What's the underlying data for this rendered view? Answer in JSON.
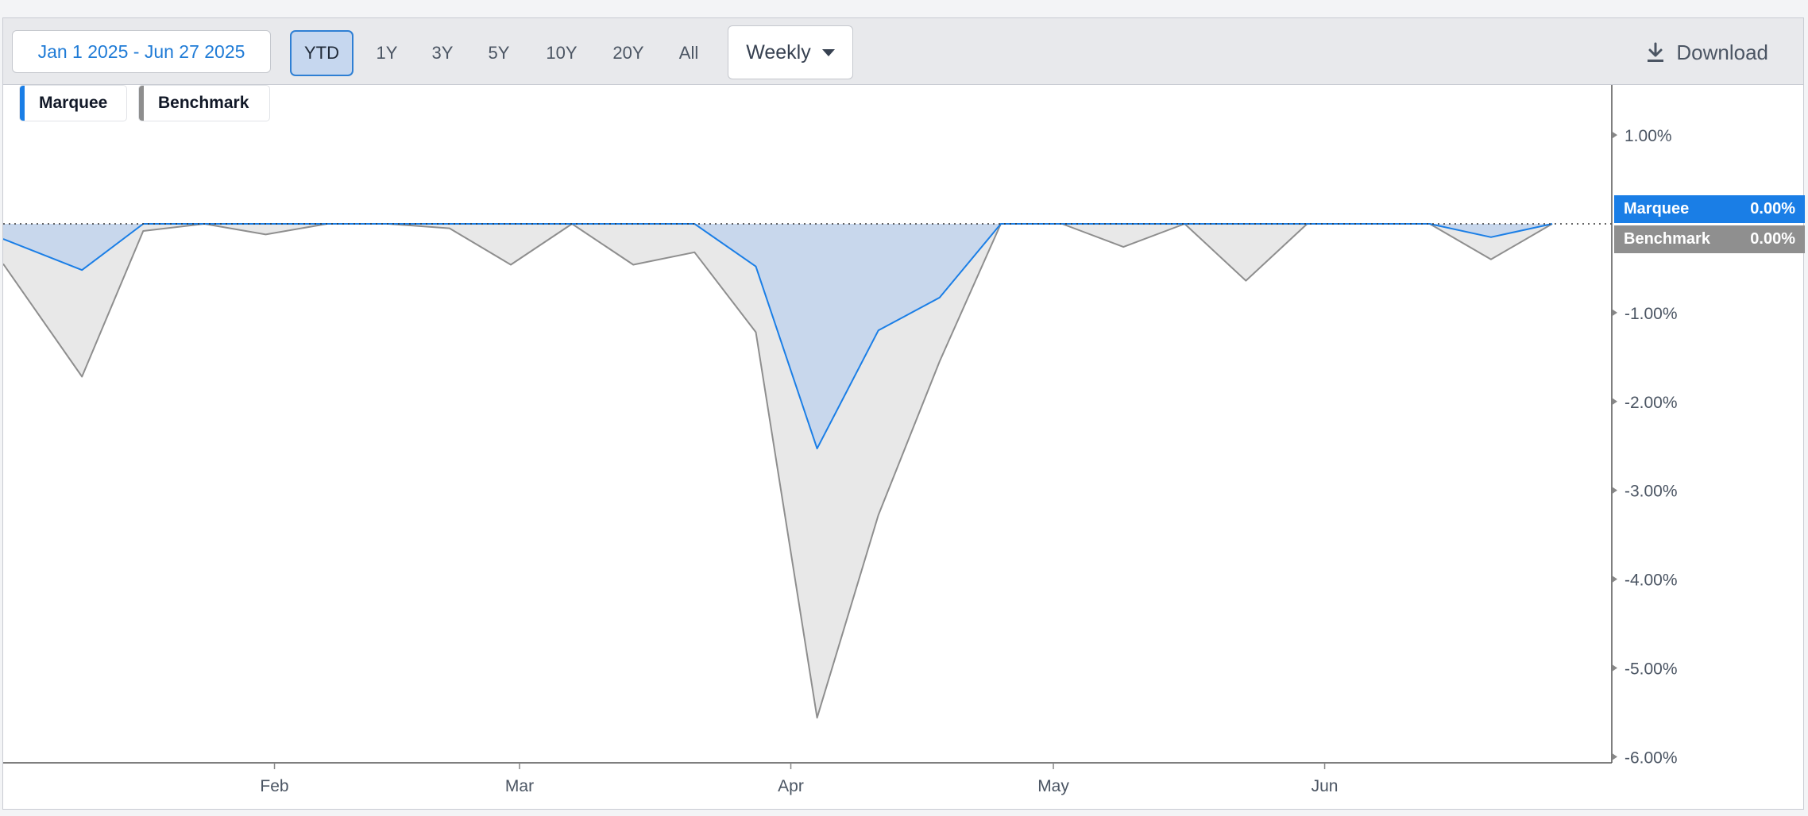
{
  "toolbar": {
    "date_range": "Jan 1 2025 - Jun 27 2025",
    "ranges": [
      "YTD",
      "1Y",
      "3Y",
      "5Y",
      "10Y",
      "20Y",
      "All"
    ],
    "active_range": "YTD",
    "frequency": "Weekly",
    "download_label": "Download"
  },
  "legend": [
    "Marquee",
    "Benchmark"
  ],
  "current_values": {
    "marquee": {
      "label": "Marquee",
      "value": "0.00%"
    },
    "benchmark": {
      "label": "Benchmark",
      "value": "0.00%"
    }
  },
  "colors": {
    "marquee": "#1a7ee6",
    "marquee_fill": "#c8d7ec",
    "benchmark": "#8e8e8e",
    "benchmark_fill": "#e8e8e8"
  },
  "chart_data": {
    "type": "area",
    "title": "",
    "xlabel": "",
    "ylabel": "",
    "x_ticks": [
      "Feb",
      "Mar",
      "Apr",
      "May",
      "Jun"
    ],
    "y_ticks": [
      "1.00%",
      "-1.00%",
      "-2.00%",
      "-3.00%",
      "-4.00%",
      "-5.00%",
      "-6.00%"
    ],
    "ylim": [
      -6.0,
      1.5
    ],
    "x": [
      "2025-01-01",
      "2025-01-10",
      "2025-01-17",
      "2025-01-24",
      "2025-01-31",
      "2025-02-07",
      "2025-02-14",
      "2025-02-21",
      "2025-02-28",
      "2025-03-07",
      "2025-03-14",
      "2025-03-21",
      "2025-03-28",
      "2025-04-04",
      "2025-04-11",
      "2025-04-18",
      "2025-04-25",
      "2025-05-02",
      "2025-05-09",
      "2025-05-16",
      "2025-05-23",
      "2025-05-30",
      "2025-06-06",
      "2025-06-13",
      "2025-06-20",
      "2025-06-27"
    ],
    "series": [
      {
        "name": "Marquee",
        "values": [
          -0.17,
          -0.52,
          0.0,
          0.0,
          0.0,
          0.0,
          0.0,
          0.0,
          0.0,
          0.0,
          0.0,
          0.0,
          -0.48,
          -2.53,
          -1.2,
          -0.83,
          0.0,
          0.0,
          0.0,
          0.0,
          0.0,
          0.0,
          0.0,
          0.0,
          -0.15,
          0.0
        ]
      },
      {
        "name": "Benchmark",
        "values": [
          -0.45,
          -1.72,
          -0.08,
          0.0,
          -0.12,
          0.0,
          0.0,
          -0.05,
          -0.46,
          0.0,
          -0.46,
          -0.32,
          -1.22,
          -5.56,
          -3.28,
          -1.55,
          0.0,
          0.0,
          -0.26,
          0.0,
          -0.64,
          0.0,
          0.0,
          0.0,
          -0.4,
          0.0
        ]
      }
    ]
  }
}
